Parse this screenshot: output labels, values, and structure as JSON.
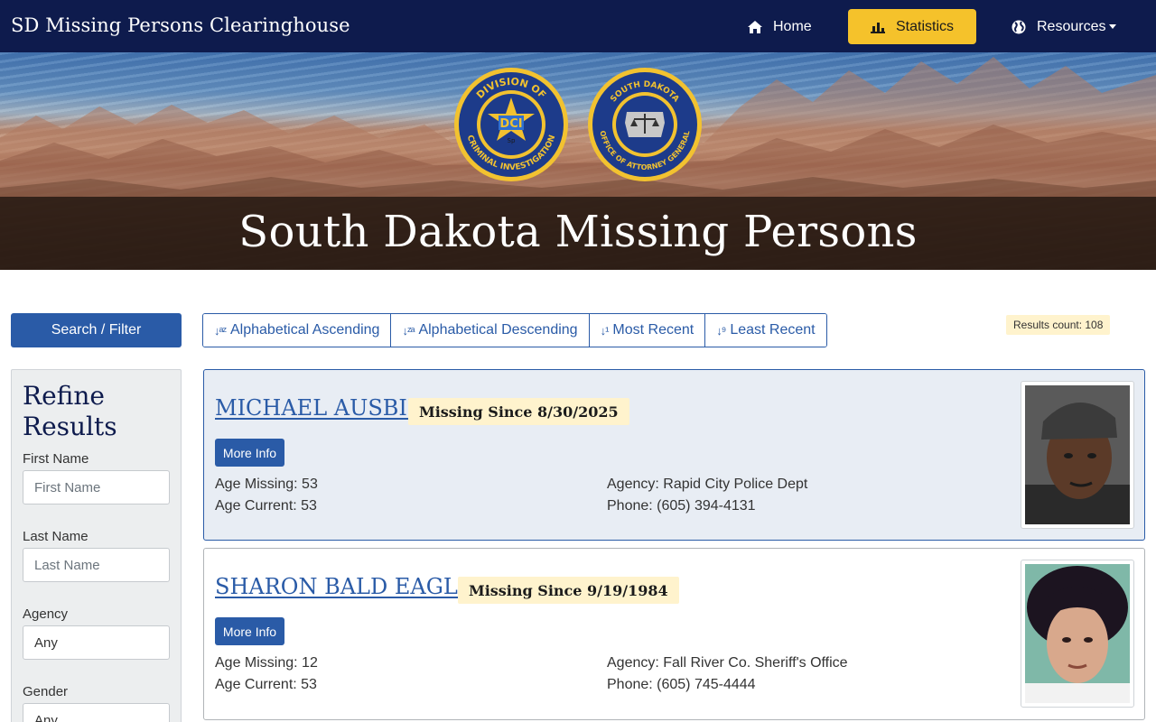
{
  "navbar": {
    "brand": "SD Missing Persons Clearinghouse",
    "home_label": "Home",
    "stats_label": "Statistics",
    "resources_label": "Resources",
    "icons": [
      "home-icon",
      "bar-chart-icon",
      "globe-icon"
    ],
    "accent_color": "#f5c22b",
    "background_color": "#0e1b4d"
  },
  "hero": {
    "title": "South Dakota Missing Persons",
    "seals": [
      {
        "name": "dci-seal",
        "text_top": "DIVISION OF",
        "text_bottom": "CRIMINAL INVESTIGATION",
        "center": "DCI",
        "sub": "Sp"
      },
      {
        "name": "attorney-general-seal",
        "text_top": "SOUTH DAKOTA",
        "text_bottom": "OFFICE OF ATTORNEY GENERAL",
        "motto": "EQUAL JUSTICE UNDER LAW"
      }
    ]
  },
  "sidebar": {
    "search_button": "Search / Filter",
    "refine_title": "Refine Results",
    "fields": [
      {
        "label": "First Name",
        "placeholder": "First Name"
      },
      {
        "label": "Last Name",
        "placeholder": "Last Name"
      },
      {
        "label": "Agency",
        "value": "Any"
      },
      {
        "label": "Gender",
        "value": "Any"
      }
    ]
  },
  "sort": {
    "buttons": [
      "Alphabetical Ascending",
      "Alphabetical Descending",
      "Most Recent",
      "Least Recent"
    ],
    "results_count": "Results count: 108"
  },
  "persons": [
    {
      "name": "MICHAEL AUSBIE",
      "missing_since": "Missing Since 8/30/2025",
      "more_info": "More Info",
      "age_missing": "Age Missing: 53",
      "age_current": "Age Current: 53",
      "agency": "Agency: Rapid City Police Dept",
      "phone": "Phone: (605) 394-4131"
    },
    {
      "name": "SHARON BALD EAGLE",
      "missing_since": "Missing Since 9/19/1984",
      "more_info": "More Info",
      "age_missing": "Age Missing: 12",
      "age_current": "Age Current: 53",
      "agency": "Agency: Fall River Co. Sheriff's Office",
      "phone": "Phone: (605) 745-4444"
    }
  ]
}
